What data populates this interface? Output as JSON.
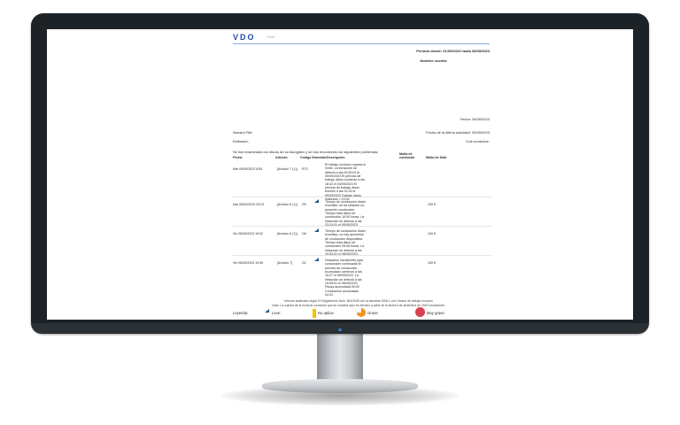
{
  "report": {
    "brand": "VDO",
    "brand_sub": "Fleet",
    "period": "Periodo desde: 01/09/2023 hasta 30/09/2023",
    "client_name_label": "Nombre cuenta:",
    "date": "Fecha: 26/08/2024",
    "our_ref_label": "Nuestro Ref.",
    "last_activity": "Fecha de la última actividad: 30/09/2023",
    "salutation": "Estimado,",
    "driver_code_label": "Cod.conductor:",
    "intro": "Se han examinado los discos de su tacógrafo y se han encontrado los siguientes problemas:",
    "columns": [
      "Fecha",
      "Artículo",
      "Código",
      "Gravedad",
      "Descripción",
      "Multa de conductor",
      "Multa de flota"
    ],
    "rows": [
      {
        "fecha": "Mar 05/09/2023 8:55",
        "articulo": "[Artículo 7 (1)]",
        "codigo": "R73",
        "gravedad": "",
        "descripcion": "El trabajo nocturno supera el límite. La infracción se detectó a las 00:30:01 el 05/09/2023 El período de trabajo diario comenzó a las 18:42 el 04/09/2023 El período de trabajo diario terminó a las 01:43 el 05/09/2023 Trabajo diario realizado = 10:42",
        "multa_conductor": "",
        "multa_flota": ""
      },
      {
        "fecha": "Mar 05/09/2023 23:24",
        "articulo": "[Artículo 6 (1)]",
        "codigo": "G9",
        "gravedad": "leve",
        "descripcion": "Tiempo de conducción diario excedido, se ha utilizado un aumento conducción. Tiempo total diario de conducción 10:00 horas. La infracción se detectó a las 23:24:01 el 05/09/2023.",
        "multa_conductor": "",
        "multa_flota": "100 €"
      },
      {
        "fecha": "Vie 08/09/2023 19:52",
        "articulo": "[Artículo 6 (1)]",
        "codigo": "G8",
        "gravedad": "leve",
        "descripcion": "Tiempo de conducción diario excedido, no hay aumentos de conducción disponibles. Tiempo total diario de conducción 09:08 horas. La infracción se detectó a las 19:53:01 el 08/09/2023.",
        "multa_conductor": "",
        "multa_flota": "100 €"
      },
      {
        "fecha": "Vie 08/09/2023 19:59",
        "articulo": "[Artículo 7]",
        "codigo": "G1",
        "gravedad": "leve",
        "descripcion": "Descanso insuficiente para conducción continuada El período de conducción acumulado comenzó a las 15:27 el 08/09/2023. La infracción se detectó a las 19:59:01 el 08/09/2023. Pausa acumulada 00:00 Conducción acumulada 04:31.",
        "multa_conductor": "",
        "multa_flota": "100 €"
      }
    ],
    "footer_line1": "Informe analizado según El Reglamento Núm. 561/2006 con la directiva 2006-1 con Horario de trabajo europeo",
    "footer_line2": "Nota: La cuantía de la multa al conductor que se muestra aquí es efectivo a partir de la fecha 6 de diciembre de 2020 únicamente.",
    "legend": {
      "title": "Leyenda:",
      "items": [
        "Leve:",
        "No aplica:",
        "Grave:",
        "Muy grave:"
      ]
    }
  },
  "colors": {
    "leve": "#1f5a8c",
    "no_aplica": "#f2c200",
    "grave": "#f0921e",
    "muy_grave": "#d9414f"
  }
}
